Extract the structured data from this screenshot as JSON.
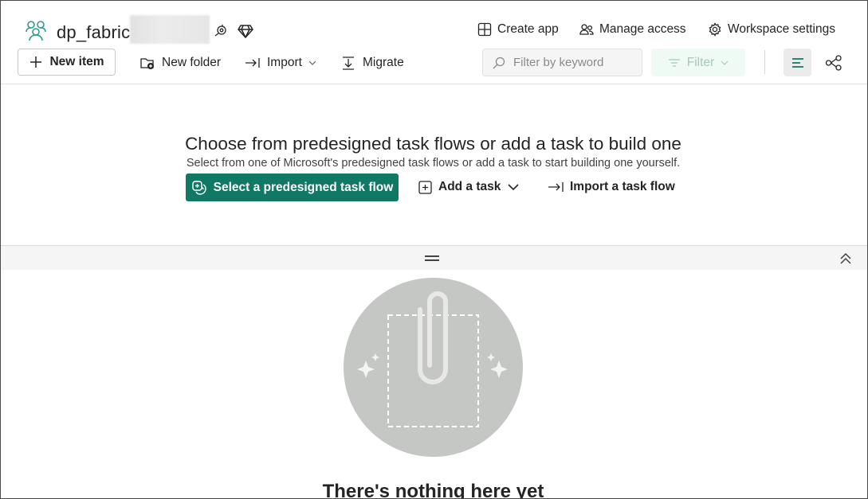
{
  "workspace": {
    "name": "dp_fabric"
  },
  "header": {
    "create_app": "Create app",
    "manage_access": "Manage access",
    "workspace_settings": "Workspace settings"
  },
  "toolbar": {
    "new_item": "New item",
    "new_folder": "New folder",
    "import": "Import",
    "migrate": "Migrate",
    "search_placeholder": "Filter by keyword",
    "filter": "Filter"
  },
  "task_flow": {
    "title": "Choose from predesigned task flows or add a task to build one",
    "subtitle": "Select from one of Microsoft's predesigned task flows or add a task to start building one yourself.",
    "select_predesigned": "Select a predesigned task flow",
    "add_task": "Add a task",
    "import_task_flow": "Import a task flow"
  },
  "empty_state": {
    "title": "There's nothing here yet"
  },
  "colors": {
    "accent": "#117865",
    "illustration_bg": "#c5c7c4"
  },
  "icons": [
    "workspace-icon",
    "plus-icon",
    "folder-add-icon",
    "import-arrow-icon",
    "migrate-icon",
    "search-icon",
    "filter-icon",
    "list-view-icon",
    "lineage-view-icon",
    "create-app-icon",
    "manage-access-icon",
    "settings-gear-icon",
    "chevron-up-double-icon",
    "paperclip-icon"
  ]
}
